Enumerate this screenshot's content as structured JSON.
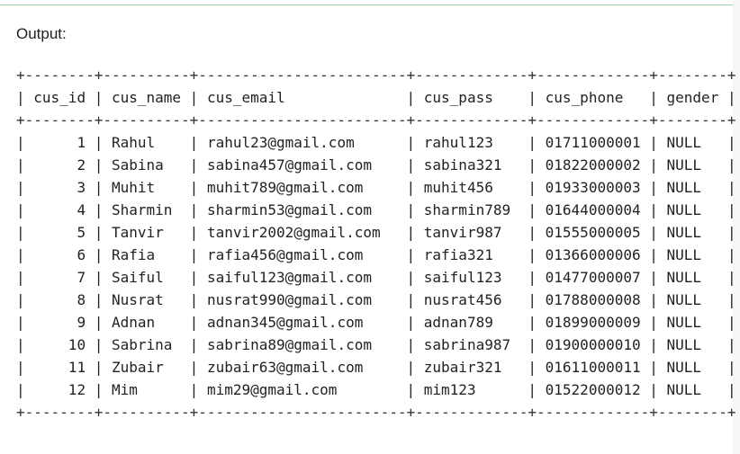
{
  "output_label": "Output:",
  "table": {
    "columns": [
      "cus_id",
      "cus_name",
      "cus_email",
      "cus_pass",
      "cus_phone",
      "gender"
    ],
    "widths": [
      8,
      10,
      24,
      13,
      13,
      8
    ],
    "align": [
      "right",
      "left",
      "left",
      "left",
      "left",
      "left"
    ],
    "rows": [
      [
        "1",
        "Rahul",
        "rahul23@gmail.com",
        "rahul123",
        "01711000001",
        "NULL"
      ],
      [
        "2",
        "Sabina",
        "sabina457@gmail.com",
        "sabina321",
        "01822000002",
        "NULL"
      ],
      [
        "3",
        "Muhit",
        "muhit789@gmail.com",
        "muhit456",
        "01933000003",
        "NULL"
      ],
      [
        "4",
        "Sharmin",
        "sharmin53@gmail.com",
        "sharmin789",
        "01644000004",
        "NULL"
      ],
      [
        "5",
        "Tanvir",
        "tanvir2002@gmail.com",
        "tanvir987",
        "01555000005",
        "NULL"
      ],
      [
        "6",
        "Rafia",
        "rafia456@gmail.com",
        "rafia321",
        "01366000006",
        "NULL"
      ],
      [
        "7",
        "Saiful",
        "saiful123@gmail.com",
        "saiful123",
        "01477000007",
        "NULL"
      ],
      [
        "8",
        "Nusrat",
        "nusrat990@gmail.com",
        "nusrat456",
        "01788000008",
        "NULL"
      ],
      [
        "9",
        "Adnan",
        "adnan345@gmail.com",
        "adnan789",
        "01899000009",
        "NULL"
      ],
      [
        "10",
        "Sabrina",
        "sabrina89@gmail.com",
        "sabrina987",
        "01900000010",
        "NULL"
      ],
      [
        "11",
        "Zubair",
        "zubair63@gmail.com",
        "zubair321",
        "01611000011",
        "NULL"
      ],
      [
        "12",
        "Mim",
        "mim29@gmail.com",
        "mim123",
        "01522000012",
        "NULL"
      ]
    ]
  }
}
